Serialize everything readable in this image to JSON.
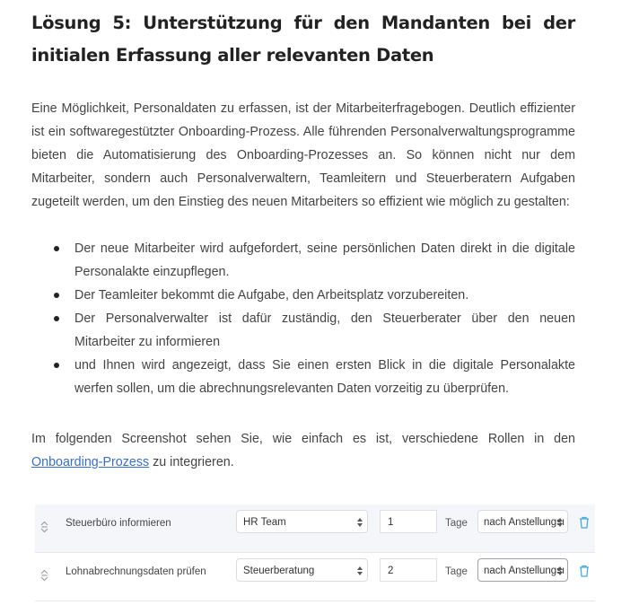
{
  "heading": "Lösung 5: Unterstützung für den Mandanten bei der initialen Erfassung aller relevanten Daten",
  "intro": "Eine Möglichkeit, Personaldaten zu erfassen, ist der Mitarbeiterfragebogen. Deutlich effizienter ist ein softwaregestützter Onboarding-Prozess. Alle führenden Personalverwaltungsprogramme bieten die Automatisierung des Onboarding-Prozesses an. So können nicht nur dem Mitarbeiter, sondern auch Personalverwaltern, Teamleitern und Steuerberatern Aufgaben zugeteilt werden, um den Einstieg des neuen Mitarbeiters so effizient wie möglich zu gestalten:",
  "bullets": [
    "Der neue Mitarbeiter wird aufgefordert, seine persönlichen Daten direkt in die digitale Personalakte einzupflegen.",
    "Der Teamleiter bekommt die Aufgabe, den Arbeitsplatz vorzubereiten.",
    "Der Personalverwalter ist dafür zuständig, den Steuerberater über den neuen Mitarbeiter zu informieren",
    "und Ihnen wird angezeigt, dass Sie einen ersten Blick in die digitale Personalakte werfen sollen, um die abrechnungsrelevanten Daten vorzeitig zu überprüfen."
  ],
  "outro": {
    "before": "Im folgenden Screenshot sehen Sie, wie einfach es ist, verschiedene Rollen in den ",
    "link": "Onboarding-Prozess",
    "after": " zu integrieren."
  },
  "colors": {
    "link": "#3a6fc4",
    "trash": "#4aa8d8",
    "row_alt_bg": "#f4f6f9"
  },
  "tasks": [
    {
      "name": "Steuerbüro informieren",
      "role": "HR Team",
      "days": "1",
      "unit": "Tage",
      "reference": "nach Anstellungsı"
    },
    {
      "name": "Lohnabrechnungsdaten prüfen",
      "role": "Steuerberatung",
      "days": "2",
      "unit": "Tage",
      "reference": "nach Anstellungsı"
    }
  ],
  "icons": {
    "drag": "drag-handle-icon",
    "select_arrows": "select-arrows-icon",
    "delete": "trash-icon"
  }
}
